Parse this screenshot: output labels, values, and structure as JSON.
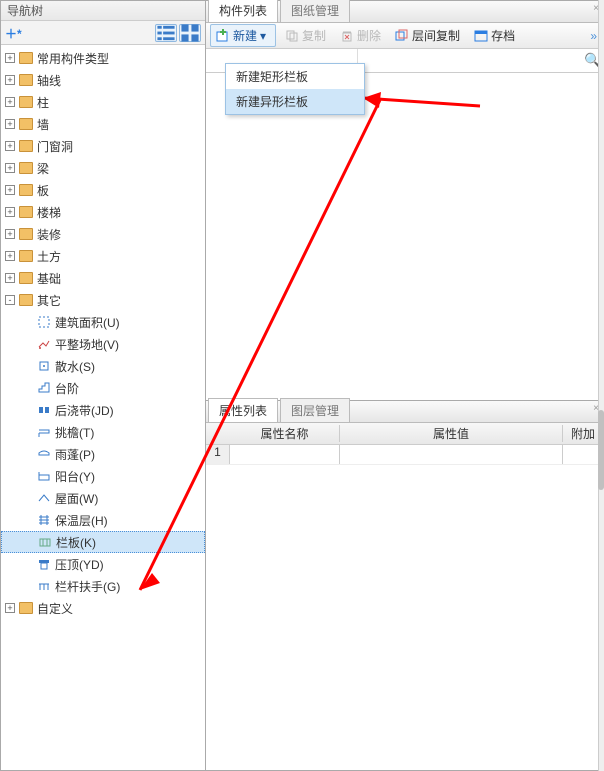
{
  "nav": {
    "title": "导航树",
    "top_nodes": [
      {
        "label": "常用构件类型"
      },
      {
        "label": "轴线"
      },
      {
        "label": "柱"
      },
      {
        "label": "墙"
      },
      {
        "label": "门窗洞"
      },
      {
        "label": "梁"
      },
      {
        "label": "板"
      },
      {
        "label": "楼梯"
      },
      {
        "label": "装修"
      },
      {
        "label": "土方"
      },
      {
        "label": "基础"
      }
    ],
    "other_label": "其它",
    "other_children": [
      {
        "label": "建筑面积(U)",
        "icon": "area"
      },
      {
        "label": "平整场地(V)",
        "icon": "level"
      },
      {
        "label": "散水(S)",
        "icon": "scatter"
      },
      {
        "label": "台阶",
        "icon": "step"
      },
      {
        "label": "后浇带(JD)",
        "icon": "postcast"
      },
      {
        "label": "挑檐(T)",
        "icon": "eave"
      },
      {
        "label": "雨蓬(P)",
        "icon": "canopy"
      },
      {
        "label": "阳台(Y)",
        "icon": "balcony"
      },
      {
        "label": "屋面(W)",
        "icon": "roof"
      },
      {
        "label": "保温层(H)",
        "icon": "insulation"
      },
      {
        "label": "栏板(K)",
        "icon": "parapet",
        "selected": true
      },
      {
        "label": "压顶(YD)",
        "icon": "coping"
      },
      {
        "label": "栏杆扶手(G)",
        "icon": "handrail"
      }
    ],
    "custom_label": "自定义"
  },
  "component_panel": {
    "tabs": [
      {
        "label": "构件列表",
        "active": true
      },
      {
        "label": "图纸管理",
        "active": false
      }
    ],
    "toolbar": {
      "new_label": "新建",
      "copy_label": "复制",
      "delete_label": "删除",
      "floor_copy_label": "层间复制",
      "archive_label": "存档"
    },
    "dropdown": [
      {
        "label": "新建矩形栏板"
      },
      {
        "label": "新建异形栏板",
        "hover": true
      }
    ],
    "search_placeholder": ""
  },
  "property_panel": {
    "tabs": [
      {
        "label": "属性列表",
        "active": true
      },
      {
        "label": "图层管理",
        "active": false
      }
    ],
    "columns": {
      "name": "属性名称",
      "value": "属性值",
      "extra": "附加"
    },
    "rows": [
      {
        "num": "1",
        "name": "",
        "value": "",
        "extra": ""
      }
    ]
  }
}
